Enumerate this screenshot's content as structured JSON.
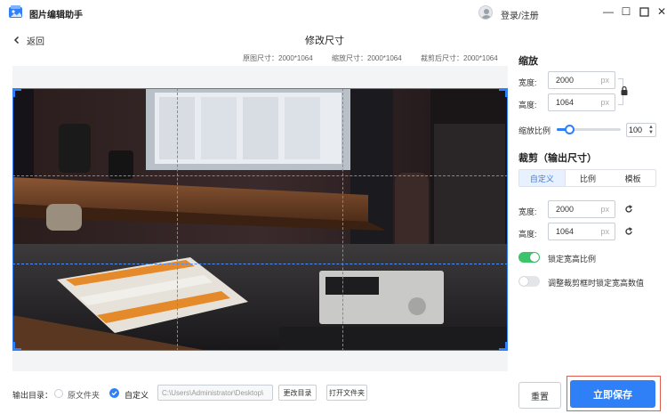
{
  "titlebar": {
    "app_title": "图片编辑助手",
    "login_label": "登录/注册",
    "minimize_glyph": "—",
    "maximize_glyph": "☐",
    "close_glyph": "✕"
  },
  "subheader": {
    "back_label": "返回",
    "title": "修改尺寸",
    "original_size": "原图尺寸：2000*1064",
    "scaled_size": "缩放尺寸：2000*1064",
    "cropped_size": "裁剪后尺寸：2000*1064"
  },
  "scale": {
    "heading": "缩放",
    "width_label": "宽度:",
    "width_value": "2000",
    "height_label": "高度:",
    "height_value": "1064",
    "unit": "px",
    "ratio_label": "缩放比例",
    "ratio_value": "100",
    "ratio_fraction": 0.2
  },
  "crop": {
    "heading": "裁剪（输出尺寸）",
    "tabs": [
      "自定义",
      "比例",
      "模板"
    ],
    "active_tab": 0,
    "width_label": "宽度:",
    "width_value": "2000",
    "height_label": "高度:",
    "height_value": "1064",
    "unit": "px",
    "lock_ratio_label": "锁定宽高比例",
    "lock_ratio_on": true,
    "lock_values_label": "调整裁剪框时锁定宽高数值",
    "lock_values_on": false
  },
  "footer": {
    "output_label": "输出目录：",
    "option_original": "原文件夹",
    "option_custom": "自定义",
    "selected_option": "custom",
    "path_value": "C:\\Users\\Administrator\\Desktop\\",
    "change_dir_label": "更改目录",
    "open_folder_label": "打开文件夹",
    "reset_label": "重置",
    "save_label": "立即保存"
  },
  "colors": {
    "accent": "#2f7ff6",
    "highlight_border": "#e05b4d",
    "toggle_on": "#3cc46a",
    "toggle_off": "#e3e5e8"
  }
}
